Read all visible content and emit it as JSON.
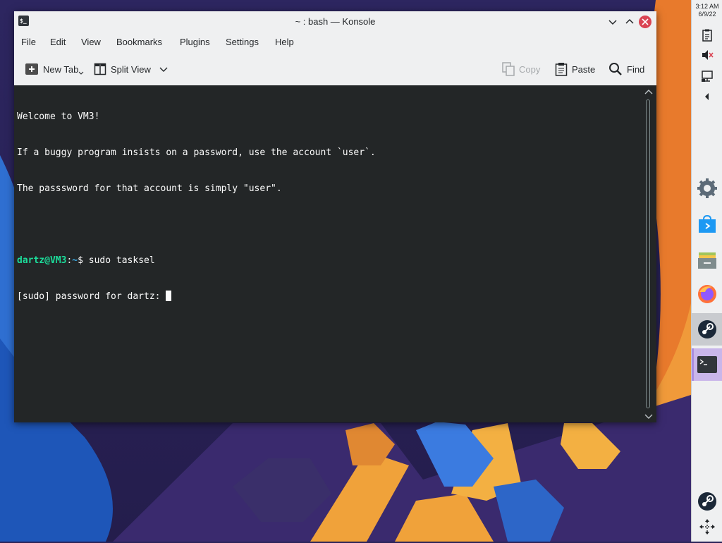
{
  "window": {
    "title": "~ : bash — Konsole",
    "app_icon_text": "$_"
  },
  "menubar": {
    "items": [
      "File",
      "Edit",
      "View",
      "Bookmarks",
      "Plugins",
      "Settings",
      "Help"
    ]
  },
  "toolbar": {
    "new_tab": "New Tab",
    "split_view": "Split View",
    "copy": "Copy",
    "paste": "Paste",
    "find": "Find"
  },
  "terminal": {
    "welcome_1": "Welcome to VM3!",
    "welcome_2": "If a buggy program insists on a password, use the account `user`.",
    "welcome_3": "The passsword for that account is simply \"user\".",
    "prompt_user": "dartz@VM3",
    "prompt_sep": ":",
    "prompt_path": "~",
    "prompt_symbol": "$ ",
    "command": "sudo tasksel",
    "sudo_prompt": "[sudo] password for dartz: "
  },
  "panel": {
    "clock_time": "3:12 AM",
    "clock_date": "6/9/22",
    "tray_icons": [
      "clipboard-icon",
      "volume-muted-icon",
      "network-icon",
      "expand-tray-icon"
    ],
    "tasks": [
      "system-settings-icon",
      "discover-store-icon",
      "file-manager-icon",
      "firefox-icon",
      "steam-icon",
      "konsole-icon"
    ],
    "bottom_icons": [
      "steam-icon",
      "move-icon"
    ]
  },
  "colors": {
    "prompt_user": "#1cdc9a",
    "prompt_path": "#3daee9",
    "terminal_bg": "#232627",
    "close_button": "#da4453",
    "active_task": "#c9b6ea"
  }
}
